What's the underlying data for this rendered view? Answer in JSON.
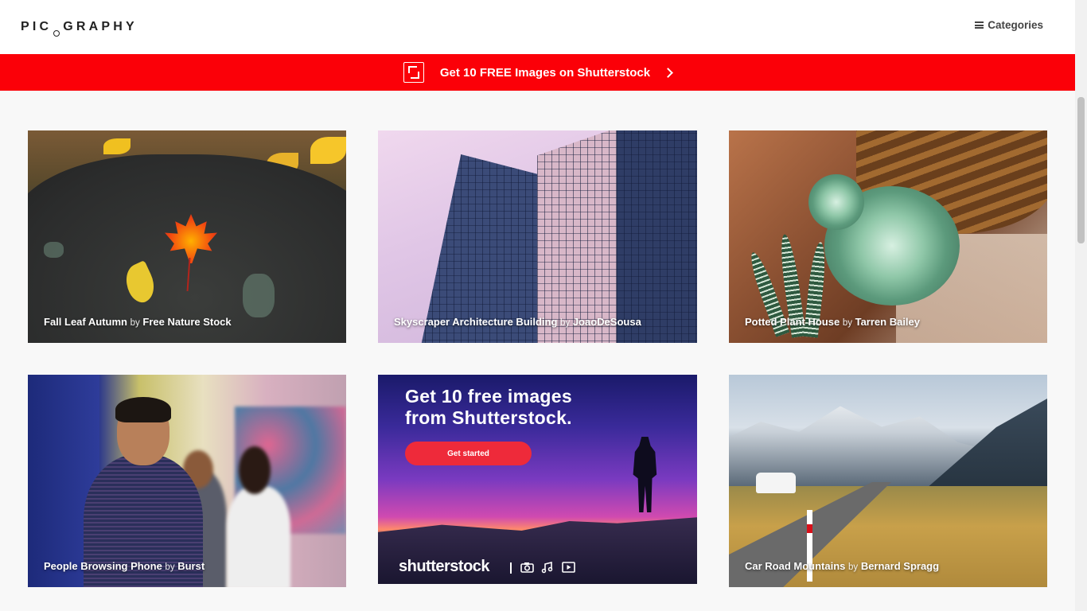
{
  "header": {
    "logo": "PICOGRAPHY",
    "categories_label": "Categories"
  },
  "promo": {
    "text": "Get 10 FREE Images on Shutterstock"
  },
  "photos": [
    {
      "title": "Fall Leaf Autumn",
      "by": "by",
      "author": "Free Nature Stock"
    },
    {
      "title": "Skyscraper Architecture Building",
      "by": "by",
      "author": "JoaoDeSousa"
    },
    {
      "title": "Potted Plant House",
      "by": "by",
      "author": "Tarren Bailey"
    },
    {
      "title": "People Browsing Phone",
      "by": "by",
      "author": "Burst"
    },
    {
      "title": "Car Road Mountains",
      "by": "by",
      "author": "Bernard Spragg"
    }
  ],
  "ad": {
    "title_line1": "Get 10 free images",
    "title_line2": "from Shutterstock.",
    "button": "Get started",
    "brand": "shutterstock",
    "icons": [
      "camera-icon",
      "music-icon",
      "video-icon"
    ]
  },
  "colors": {
    "promo_red": "#fb0008",
    "ad_button_red": "#ee2a3a",
    "page_bg": "#f8f8f8"
  }
}
